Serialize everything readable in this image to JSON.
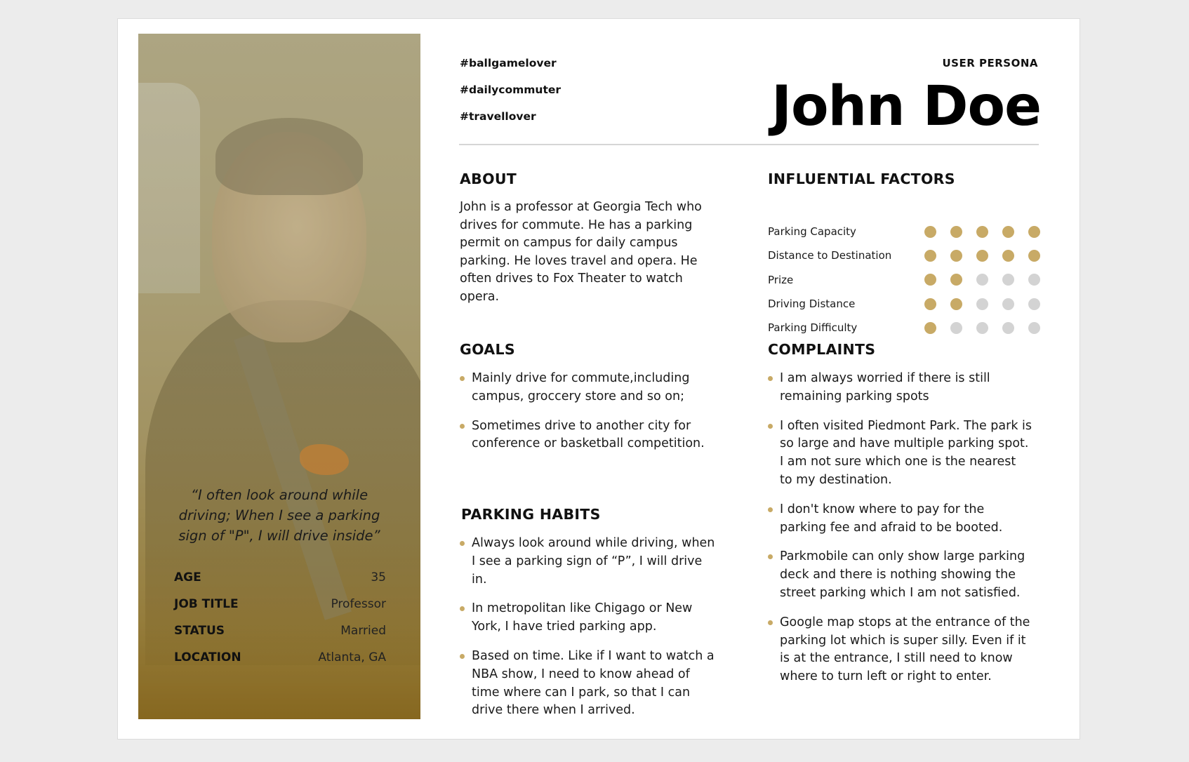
{
  "persona": {
    "kicker": "USER PERSONA",
    "name": "John Doe",
    "tags": [
      "#ballgamelover",
      "#dailycommuter",
      "#travellover"
    ],
    "quote": "“I often look around while driving; When I see a parking sign of \"P\", I will drive inside”",
    "facts": [
      {
        "label": "AGE",
        "value": "35"
      },
      {
        "label": "JOB TITLE",
        "value": "Professor"
      },
      {
        "label": "STATUS",
        "value": "Married"
      },
      {
        "label": "LOCATION",
        "value": "Atlanta, GA"
      }
    ]
  },
  "about": {
    "title": "ABOUT",
    "text": "John is a professor at Georgia Tech who drives for commute. He has a parking permit on campus for daily campus parking. He loves travel and opera. He often drives to Fox Theater to watch opera."
  },
  "goals": {
    "title": "GOALS",
    "items": [
      "Mainly drive for commute,including campus, groccery store and so on;",
      "Sometimes drive to another city for conference or basketball competition."
    ]
  },
  "habits": {
    "title": "PARKING HABITS",
    "items": [
      "Always look around while driving, when I see a parking sign of “P”, I will drive in.",
      " In metropolitan like Chigago or New York, I have tried parking app.",
      "Based on time. Like if I want to watch a NBA show, I need to know ahead of time where can I park, so that I can drive there when I arrived."
    ]
  },
  "factors": {
    "title": "INFLUENTIAL FACTORS",
    "max": 5,
    "items": [
      {
        "label": "Parking Capacity",
        "rating": 5
      },
      {
        "label": "Distance to Destination",
        "rating": 5
      },
      {
        "label": "Prize",
        "rating": 2
      },
      {
        "label": "Driving Distance",
        "rating": 2
      },
      {
        "label": "Parking Difficulty",
        "rating": 1
      }
    ]
  },
  "complaints": {
    "title": "COMPLAINTS",
    "items": [
      "I am always worried if there is still remaining parking spots",
      "I often visited Piedmont Park.  The park is so large and have multiple parking spot. I am not sure which one is the nearest to my destination.",
      "I don't know where to pay for the parking fee and afraid to be booted.",
      " Parkmobile can only show large parking deck and there is nothing showing the street parking which I am not satisfied.",
      " Google map stops at the entrance of the parking lot which is super silly. Even if it is at the entrance, I still need to know where to turn left or right to enter."
    ]
  },
  "colors": {
    "accent": "#c8aa66",
    "inactive": "#d3d3d3"
  }
}
